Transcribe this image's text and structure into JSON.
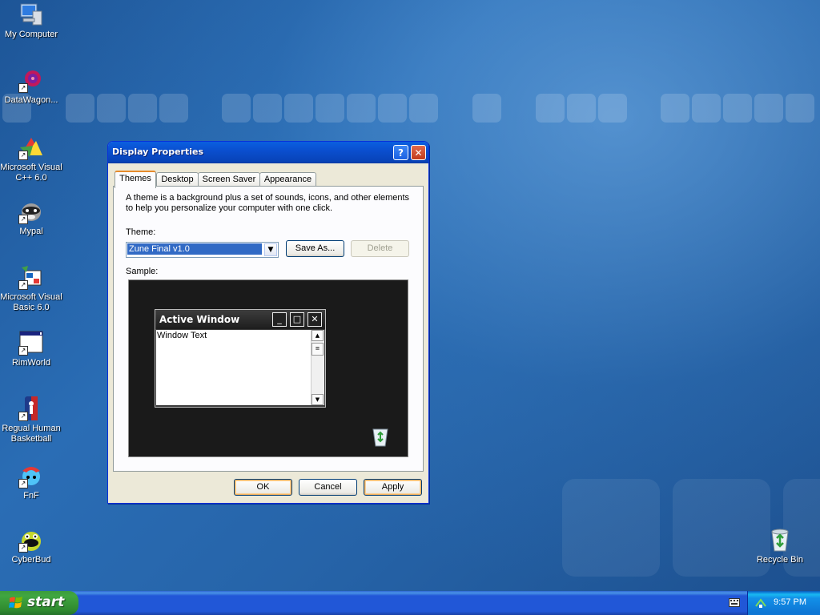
{
  "desktop": {
    "icons": [
      {
        "label": "My Computer"
      },
      {
        "label": "DataWagon..."
      },
      {
        "label": "Microsoft Visual C++ 6.0"
      },
      {
        "label": "Mypal"
      },
      {
        "label": "Microsoft Visual Basic 6.0"
      },
      {
        "label": "RimWorld"
      },
      {
        "label": "Regual Human Basketball"
      },
      {
        "label": "FnF"
      },
      {
        "label": "CyberBud"
      },
      {
        "label": "Recycle Bin"
      }
    ]
  },
  "dialog": {
    "title": "Display Properties",
    "help_glyph": "?",
    "close_glyph": "✕",
    "tabs": [
      "Themes",
      "Desktop",
      "Screen Saver",
      "Appearance"
    ],
    "active_tab": "Themes",
    "description": "A theme is a background plus a set of sounds, icons, and other elements to help you personalize your computer with one click.",
    "theme_label": "Theme:",
    "theme_value": "Zune Final v1.0",
    "save_as_label": "Save As...",
    "delete_label": "Delete",
    "sample_label": "Sample:",
    "sample": {
      "window_title": "Active Window",
      "window_text": "Window Text"
    },
    "ok_label": "OK",
    "cancel_label": "Cancel",
    "apply_label": "Apply"
  },
  "taskbar": {
    "start_label": "start",
    "clock": "9:57 PM"
  },
  "colors": {
    "desktop": "#2664a9",
    "titlebar": "#0a4fcf",
    "selection": "#316ac5",
    "start_button": "#3c9c3c"
  }
}
